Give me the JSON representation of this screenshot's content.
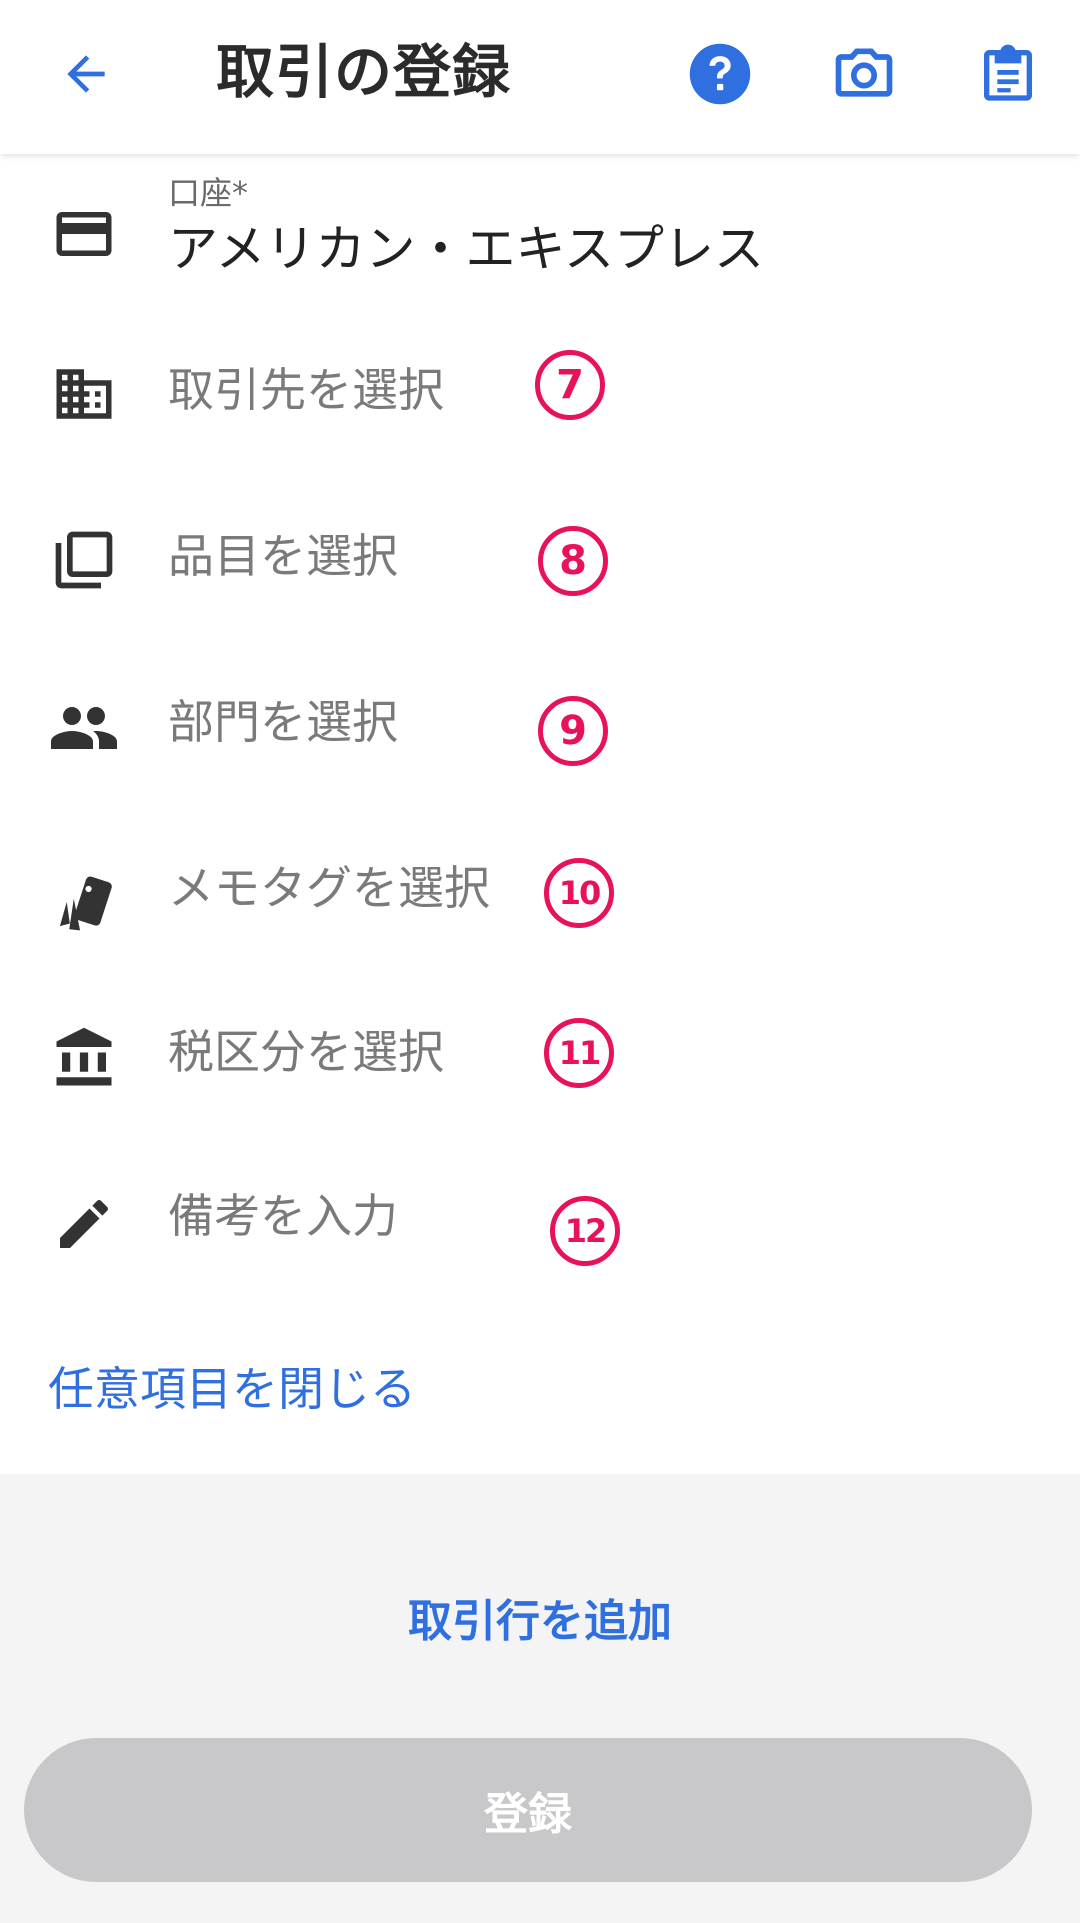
{
  "header": {
    "title": "取引の登録",
    "icons": [
      "back-arrow-icon",
      "help-icon",
      "camera-icon",
      "clipboard-icon"
    ],
    "accent": "#2f6fe0"
  },
  "account": {
    "label": "口座*",
    "value": "アメリカン・エキスプレス"
  },
  "rows": [
    {
      "label": "取引先を選択",
      "badge": "7"
    },
    {
      "label": "品目を選択",
      "badge": "8"
    },
    {
      "label": "部門を選択",
      "badge": "9"
    },
    {
      "label": "メモタグを選択",
      "badge": "10"
    },
    {
      "label": "税区分を選択",
      "badge": "11"
    },
    {
      "label": "備考を入力",
      "badge": "12"
    }
  ],
  "close_optional": "任意項目を閉じる",
  "add_line": "取引行を追加",
  "register": "登録",
  "colors": {
    "badge": "#e8125c",
    "register_disabled": "#c8c7c9",
    "bottom_bg": "#f5f4f5"
  }
}
